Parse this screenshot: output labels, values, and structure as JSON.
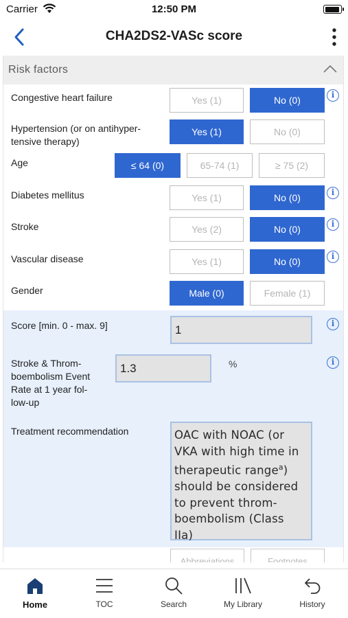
{
  "status_bar": {
    "carrier": "Carrier",
    "time": "12:50 PM"
  },
  "header": {
    "title": "CHA2DS2-VASc score",
    "back_icon": "chevron-left-icon",
    "menu_icon": "more-vertical-icon"
  },
  "section": {
    "title": "Risk factors",
    "collapse_icon": "chevron-up-icon"
  },
  "risk_factors": {
    "chf": {
      "label": "Congestive heart failure",
      "yes": "Yes (1)",
      "no": "No (0)",
      "selected": "no"
    },
    "hypertension": {
      "label_line1": "Hypertension (or on antihyper-",
      "label_line2": "tensive therapy)",
      "yes": "Yes (1)",
      "no": "No (0)",
      "selected": "yes"
    },
    "age": {
      "label": "Age",
      "opt1": "≤ 64 (0)",
      "opt2": "65-74 (1)",
      "opt3": "≥ 75 (2)",
      "selected": "opt1"
    },
    "diabetes": {
      "label": "Diabetes mellitus",
      "yes": "Yes (1)",
      "no": "No (0)",
      "selected": "no"
    },
    "stroke": {
      "label": "Stroke",
      "yes": "Yes (2)",
      "no": "No (0)",
      "selected": "no"
    },
    "vascular": {
      "label": "Vascular disease",
      "yes": "Yes (1)",
      "no": "No (0)",
      "selected": "no"
    },
    "gender": {
      "label": "Gender",
      "male": "Male (0)",
      "female": "Female (1)",
      "selected": "male"
    }
  },
  "results": {
    "score_label": "Score [min. 0 - max. 9]",
    "score_value": "1",
    "rate_label_lines": [
      "Stroke & Throm-",
      "boembolism Event",
      "Rate at 1 year fol-",
      "low-up"
    ],
    "rate_value": "1.3",
    "rate_unit": "%",
    "treatment_label": "Treatment recommendation",
    "treatment_lines": [
      "OAC with NOAC (or",
      "VKA with high time in",
      "therapeutic range",
      "should be considered",
      "to prevent throm-",
      "boembolism (Class",
      "IIa)"
    ],
    "treatment_superscript": "a",
    "treatment_suffix": ")"
  },
  "footer_buttons": {
    "abbreviations": "Abbreviations",
    "footnotes": "Footnotes"
  },
  "tabs": [
    {
      "label": "Home",
      "icon": "home-icon",
      "active": true
    },
    {
      "label": "TOC",
      "icon": "list-icon",
      "active": false
    },
    {
      "label": "Search",
      "icon": "search-icon",
      "active": false
    },
    {
      "label": "My Library",
      "icon": "library-icon",
      "active": false
    },
    {
      "label": "History",
      "icon": "undo-icon",
      "active": false
    }
  ],
  "colors": {
    "accent": "#2f67d0",
    "results_bg": "#e7f0fb",
    "header_bg": "#eeeeee"
  }
}
